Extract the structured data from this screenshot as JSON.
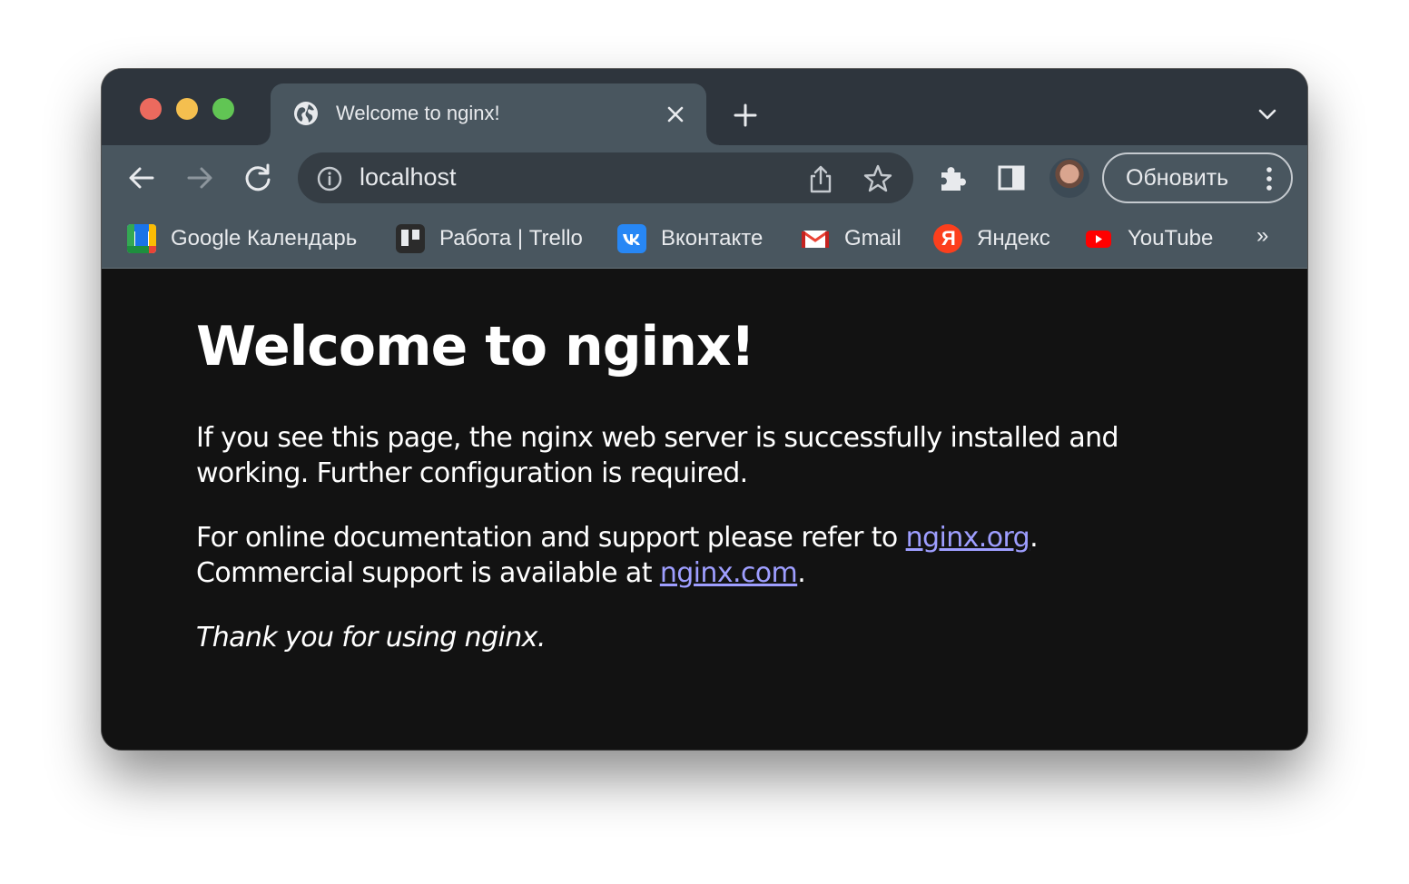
{
  "browser": {
    "tab": {
      "title": "Welcome to nginx!"
    },
    "address_bar": {
      "url": "localhost"
    },
    "update_button": {
      "label": "Обновить"
    },
    "bookmarks": [
      {
        "label": "Google Календарь",
        "icon": "google-calendar-icon"
      },
      {
        "label": "Работа | Trello",
        "icon": "trello-icon"
      },
      {
        "label": "Вконтакте",
        "icon": "vk-icon"
      },
      {
        "label": "Gmail",
        "icon": "gmail-icon"
      },
      {
        "label": "Яндекс",
        "icon": "yandex-icon"
      },
      {
        "label": "YouTube",
        "icon": "youtube-icon"
      }
    ],
    "bookmarks_overflow": "»",
    "colors": {
      "tab_strip": "#2e353d",
      "toolbar": "#49565f",
      "page_background": "#121212",
      "link": "#9e9eff"
    }
  },
  "page": {
    "heading": "Welcome to nginx!",
    "paragraph1": "If you see this page, the nginx web server is successfully installed and working. Further configuration is required.",
    "paragraph2": {
      "text_before_link1": "For online documentation and support please refer to ",
      "link1": "nginx.org",
      "text_after_link1": ".",
      "text_before_link2": "Commercial support is available at ",
      "link2": "nginx.com",
      "text_after_link2": "."
    },
    "paragraph3": "Thank you for using nginx."
  }
}
